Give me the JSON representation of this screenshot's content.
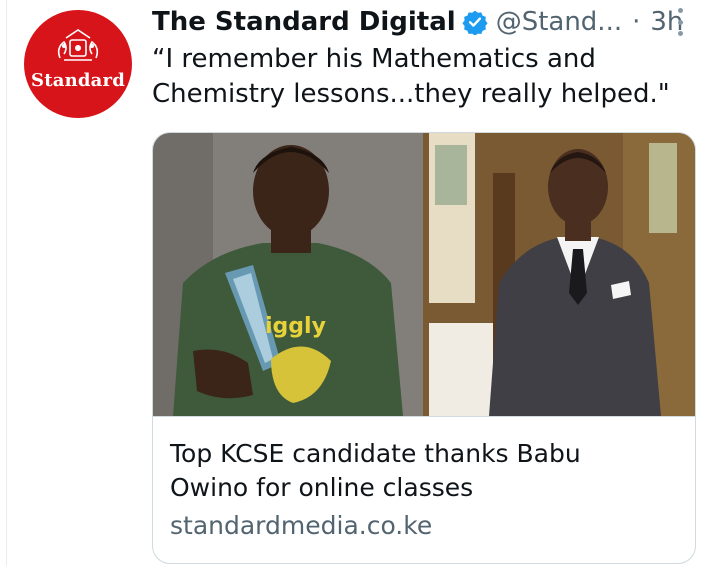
{
  "account": {
    "display_name": "The Standard Digital",
    "handle": "@Stand...",
    "separator": "·",
    "time": "3h",
    "avatar_text": "Standard",
    "brand_color": "#d7141a",
    "verified_icon": "verified-badge-icon"
  },
  "tweet": {
    "text_line1": "“I remember his Mathematics and",
    "text_line2": "Chemistry lessons...they really helped.\""
  },
  "card": {
    "title_line1": "Top KCSE candidate thanks Babu",
    "title_line2": "Owino for online classes",
    "domain": "standardmedia.co.ke",
    "shirt_text": "iggly"
  },
  "colors": {
    "text": "#0f1419",
    "secondary": "#536471",
    "border": "#cfd9de",
    "verified": "#1d9bf0"
  }
}
